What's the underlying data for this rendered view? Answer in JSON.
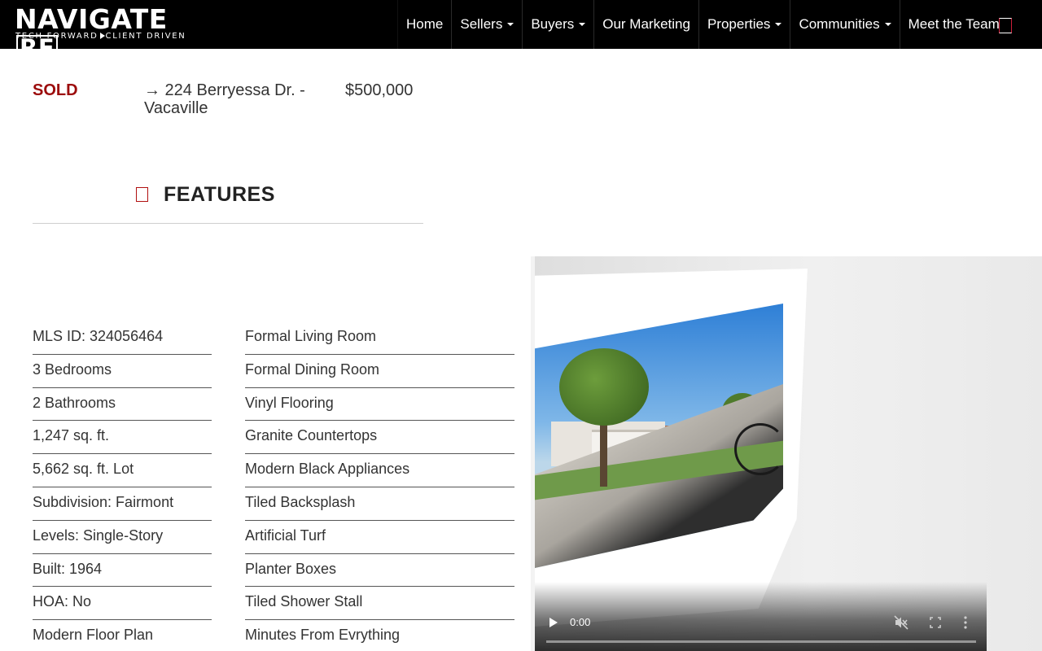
{
  "brand": {
    "logo_main": "NAVIGATE",
    "logo_re": "RE",
    "tagline_left": "TECH FORWARD",
    "tagline_right": "CLIENT DRIVEN"
  },
  "nav": {
    "items": [
      {
        "label": "Home",
        "dropdown": false
      },
      {
        "label": "Sellers",
        "dropdown": true
      },
      {
        "label": "Buyers",
        "dropdown": true
      },
      {
        "label": "Our Marketing",
        "dropdown": false
      },
      {
        "label": "Properties",
        "dropdown": true
      },
      {
        "label": "Communities",
        "dropdown": true
      },
      {
        "label": "Meet the Team",
        "dropdown": false
      }
    ],
    "icon": "phone-icon"
  },
  "listing": {
    "status": "SOLD",
    "address": "→ 224 Berryessa Dr. - Vacaville",
    "price": "$500,000"
  },
  "features": {
    "heading": "FEATURES",
    "icon": "list-icon",
    "left": [
      "MLS ID: 324056464",
      "3 Bedrooms",
      "2 Bathrooms",
      "1,247 sq. ft.",
      "5,662 sq. ft. Lot",
      "Subdivision: Fairmont",
      "Levels: Single-Story",
      "Built: 1964",
      "HOA: No",
      "Modern Floor Plan"
    ],
    "right": [
      "Formal Living Room",
      "Formal Dining Room",
      "Vinyl Flooring",
      "Granite Countertops",
      "Modern Black Appliances",
      "Tiled Backsplash",
      "Artificial Turf",
      "Planter Boxes",
      "Tiled Shower Stall",
      "Minutes From Evrything"
    ]
  },
  "video": {
    "current_time": "0:00",
    "progress": 0,
    "muted": true,
    "icons": [
      "play-icon",
      "mute-icon",
      "fullscreen-icon",
      "more-options-icon",
      "loading-spinner"
    ]
  },
  "colors": {
    "navbar": "#000000",
    "sold": "#9c0c0c",
    "accent": "#cc1f39"
  }
}
